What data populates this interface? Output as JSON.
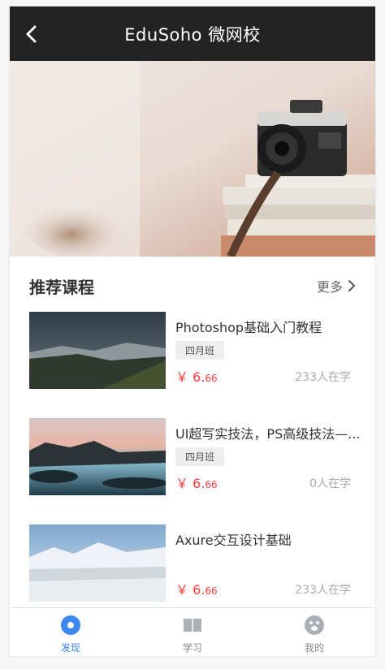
{
  "header": {
    "title": "EduSoho 微网校",
    "back_icon": "chevron-left-icon"
  },
  "banner": {
    "alt": ""
  },
  "section": {
    "title": "推荐课程",
    "more_label": "更多"
  },
  "courses": [
    {
      "title": "Photoshop基础入门教程",
      "tag": "四月班",
      "price_symbol": "￥",
      "price_main": "6.",
      "price_decimal": "66",
      "students": "233人在学"
    },
    {
      "title": "UI超写实技法，PS高级技法—...",
      "tag": "四月班",
      "price_symbol": "￥",
      "price_main": "6.",
      "price_decimal": "66",
      "students": "0人在学"
    },
    {
      "title": "Axure交互设计基础",
      "tag": "",
      "price_symbol": "￥",
      "price_main": "6.",
      "price_decimal": "66",
      "students": "233人在学"
    }
  ],
  "tabbar": {
    "items": [
      {
        "label": "发现",
        "icon": "discover-icon",
        "active": true
      },
      {
        "label": "学习",
        "icon": "book-icon",
        "active": false
      },
      {
        "label": "我的",
        "icon": "profile-icon",
        "active": false
      }
    ]
  },
  "colors": {
    "accent": "#3b86f0",
    "price": "#ff3b3b",
    "topbar": "#232323"
  }
}
